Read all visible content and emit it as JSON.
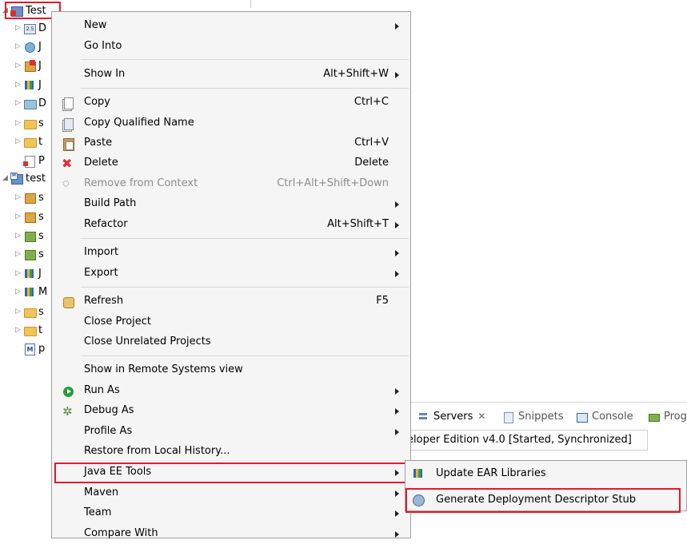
{
  "tree": {
    "rows": [
      {
        "label": "Test",
        "icon": "web-project-error-icon",
        "expanded": true
      },
      {
        "label": "D",
        "icon": "deployment-descriptor-icon"
      },
      {
        "label": "J",
        "icon": "jax-ws-icon"
      },
      {
        "label": "J",
        "icon": "javascript-resources-icon"
      },
      {
        "label": "J",
        "icon": "java-library-icon"
      },
      {
        "label": "D",
        "icon": "deployed-resources-icon"
      },
      {
        "label": "s",
        "icon": "folder-icon"
      },
      {
        "label": "t",
        "icon": "folder-icon"
      },
      {
        "label": "P",
        "icon": "xml-file-error-icon"
      },
      {
        "label": "test",
        "icon": "maven-project-icon",
        "expanded": true
      },
      {
        "label": "s",
        "icon": "source-package-icon"
      },
      {
        "label": "s",
        "icon": "source-package-icon"
      },
      {
        "label": "s",
        "icon": "test-package-icon"
      },
      {
        "label": "s",
        "icon": "test-package-icon"
      },
      {
        "label": "J",
        "icon": "jre-library-icon"
      },
      {
        "label": "M",
        "icon": "maven-library-icon"
      },
      {
        "label": "s",
        "icon": "folder-icon"
      },
      {
        "label": "t",
        "icon": "folder-icon"
      },
      {
        "label": "p",
        "icon": "pom-file-icon"
      }
    ]
  },
  "menu": {
    "new": "New",
    "go_into": "Go Into",
    "show_in": "Show In",
    "show_in_acc": "Alt+Shift+W",
    "copy": "Copy",
    "copy_acc": "Ctrl+C",
    "copy_qualified": "Copy Qualified Name",
    "paste": "Paste",
    "paste_acc": "Ctrl+V",
    "delete": "Delete",
    "delete_acc": "Delete",
    "remove_context": "Remove from Context",
    "remove_context_acc": "Ctrl+Alt+Shift+Down",
    "build_path": "Build Path",
    "refactor": "Refactor",
    "refactor_acc": "Alt+Shift+T",
    "import": "Import",
    "export": "Export",
    "refresh": "Refresh",
    "refresh_acc": "F5",
    "close_project": "Close Project",
    "close_unrelated": "Close Unrelated Projects",
    "show_remote": "Show in Remote Systems view",
    "run_as": "Run As",
    "debug_as": "Debug As",
    "profile_as": "Profile As",
    "restore_history": "Restore from Local History...",
    "java_ee_tools": "Java EE Tools",
    "maven": "Maven",
    "team": "Team",
    "compare_with": "Compare With"
  },
  "views": {
    "servers": "Servers",
    "servers_close": "✕",
    "snippets": "Snippets",
    "console": "Console",
    "progress": "Prog",
    "server_entry": "eloper Edition v4.0  [Started, Synchronized]"
  },
  "submenu": {
    "update_ear": "Update EAR Libraries",
    "generate_stub": "Generate Deployment Descriptor Stub"
  },
  "colors": {
    "highlight_border": "#e21a2c",
    "menu_bg": "#f5f5f5",
    "disabled_text": "#8c8c8c"
  }
}
